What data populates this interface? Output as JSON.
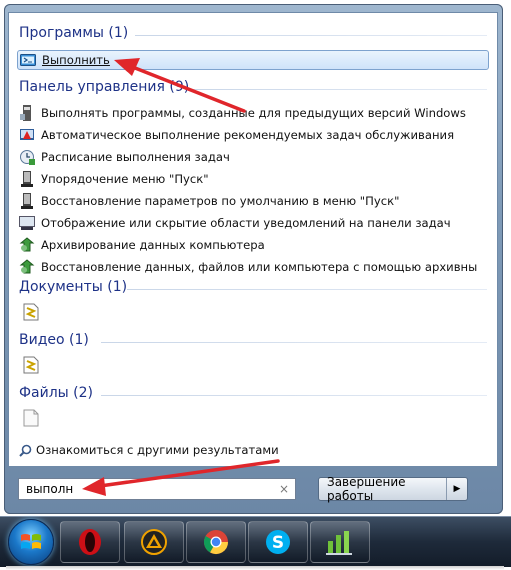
{
  "groups": {
    "programs": {
      "header": "Программы (1)",
      "items": [
        {
          "label": "Выполнить",
          "icon": "run-icon"
        }
      ]
    },
    "control_panel": {
      "header": "Панель управления (9)",
      "items": [
        {
          "label": "Выполнять программы, созданные для предыдущих версий Windows",
          "icon": "compat-icon"
        },
        {
          "label": "Автоматическое выполнение рекомендуемых задач обслуживания",
          "icon": "action-center-icon"
        },
        {
          "label": "Расписание выполнения задач",
          "icon": "scheduler-icon"
        },
        {
          "label": "Упорядочение меню \"Пуск\"",
          "icon": "taskbar-icon"
        },
        {
          "label": "Восстановление параметров по умолчанию в меню \"Пуск\"",
          "icon": "taskbar-icon"
        },
        {
          "label": "Отображение или скрытие области уведомлений на панели задач",
          "icon": "notification-icon"
        },
        {
          "label": "Архивирование данных компьютера",
          "icon": "backup-icon"
        },
        {
          "label": "Восстановление данных, файлов или компьютера с помощью архивных ко...",
          "icon": "backup-icon"
        }
      ]
    },
    "documents": {
      "header": "Документы (1)",
      "icon": "document-file-icon"
    },
    "video": {
      "header": "Видео (1)",
      "icon": "video-file-icon"
    },
    "files": {
      "header": "Файлы (2)",
      "icon": "blank-file-icon"
    }
  },
  "more_results": "Ознакомиться с другими результатами",
  "search": {
    "value": "выполн",
    "clear_glyph": "×"
  },
  "shutdown": {
    "label": "Завершение работы",
    "arrow_glyph": "▶"
  },
  "taskbar": {
    "pinned": [
      "opera-icon",
      "aimp-icon",
      "chrome-icon",
      "skype-icon",
      "traffic-monitor-icon"
    ]
  },
  "colors": {
    "header_text": "#1e3287",
    "selection_border": "#7da2ce",
    "annotation_arrow": "#e0262b"
  }
}
